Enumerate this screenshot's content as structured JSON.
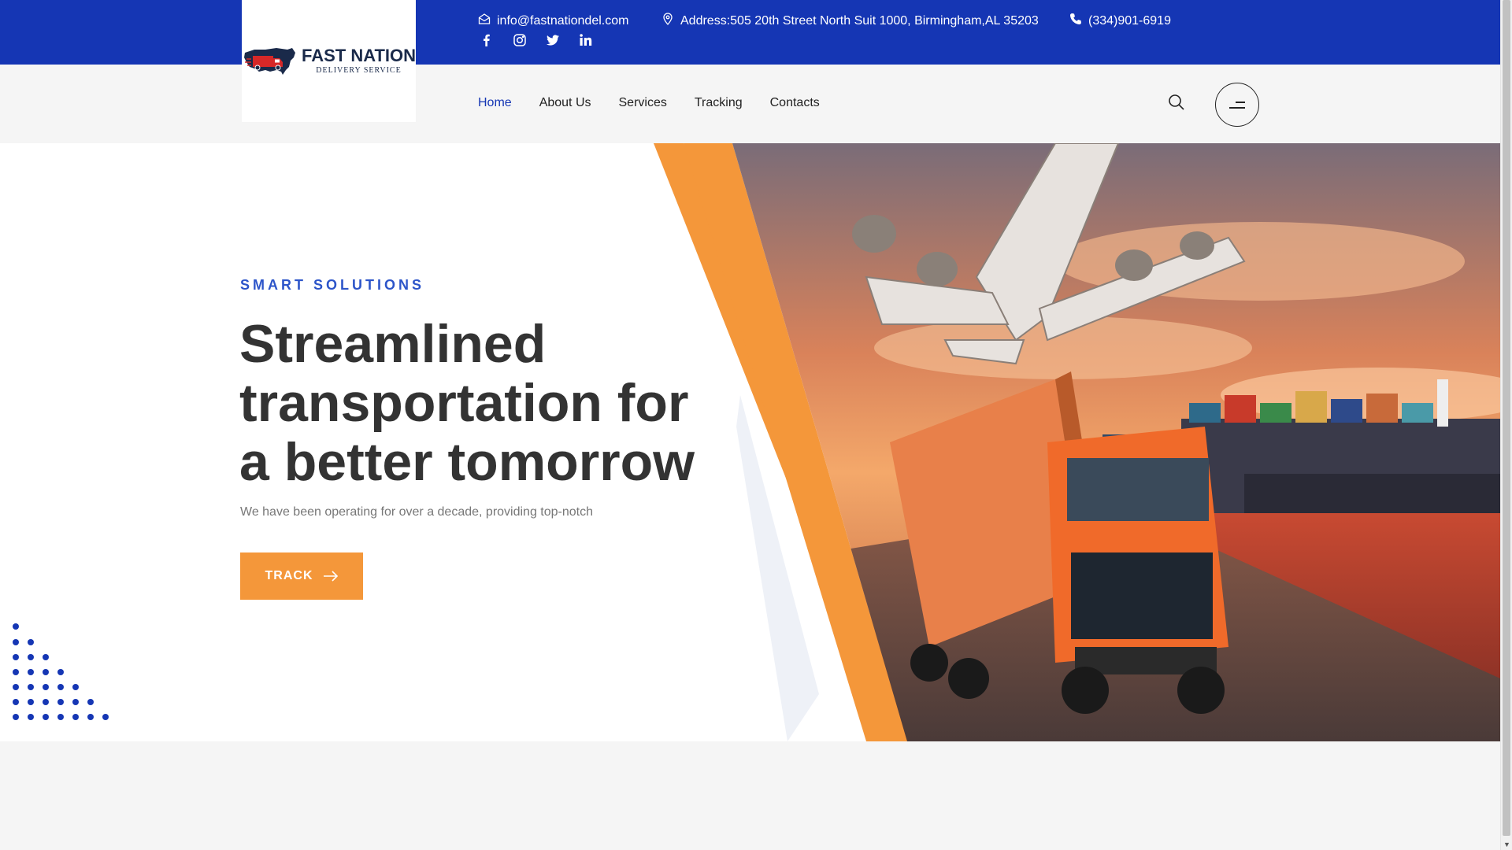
{
  "topbar": {
    "email": "info@fastnationdel.com",
    "address": "Address:505 20th Street North Suit 1000, Birmingham,AL 35203",
    "phone": "(334)901-6919",
    "socials": [
      "facebook-icon",
      "instagram-icon",
      "twitter-icon",
      "linkedin-icon"
    ]
  },
  "logo": {
    "name": "FAST NATION",
    "tagline": "DELIVERY SERVICE"
  },
  "nav": {
    "items": [
      {
        "label": "Home",
        "active": true
      },
      {
        "label": "About Us",
        "active": false
      },
      {
        "label": "Services",
        "active": false
      },
      {
        "label": "Tracking",
        "active": false
      },
      {
        "label": "Contacts",
        "active": false
      }
    ]
  },
  "hero": {
    "eyebrow": "SMART SOLUTIONS",
    "headline_1": "Streamlined",
    "headline_2": "transportation for",
    "headline_3": "a better tomorrow",
    "lead": "We have been operating for over a decade, providing top-notch",
    "cta_label": "TRACK"
  },
  "colors": {
    "primary": "#1536b4",
    "accent": "#f4973a",
    "heading": "#333333"
  }
}
